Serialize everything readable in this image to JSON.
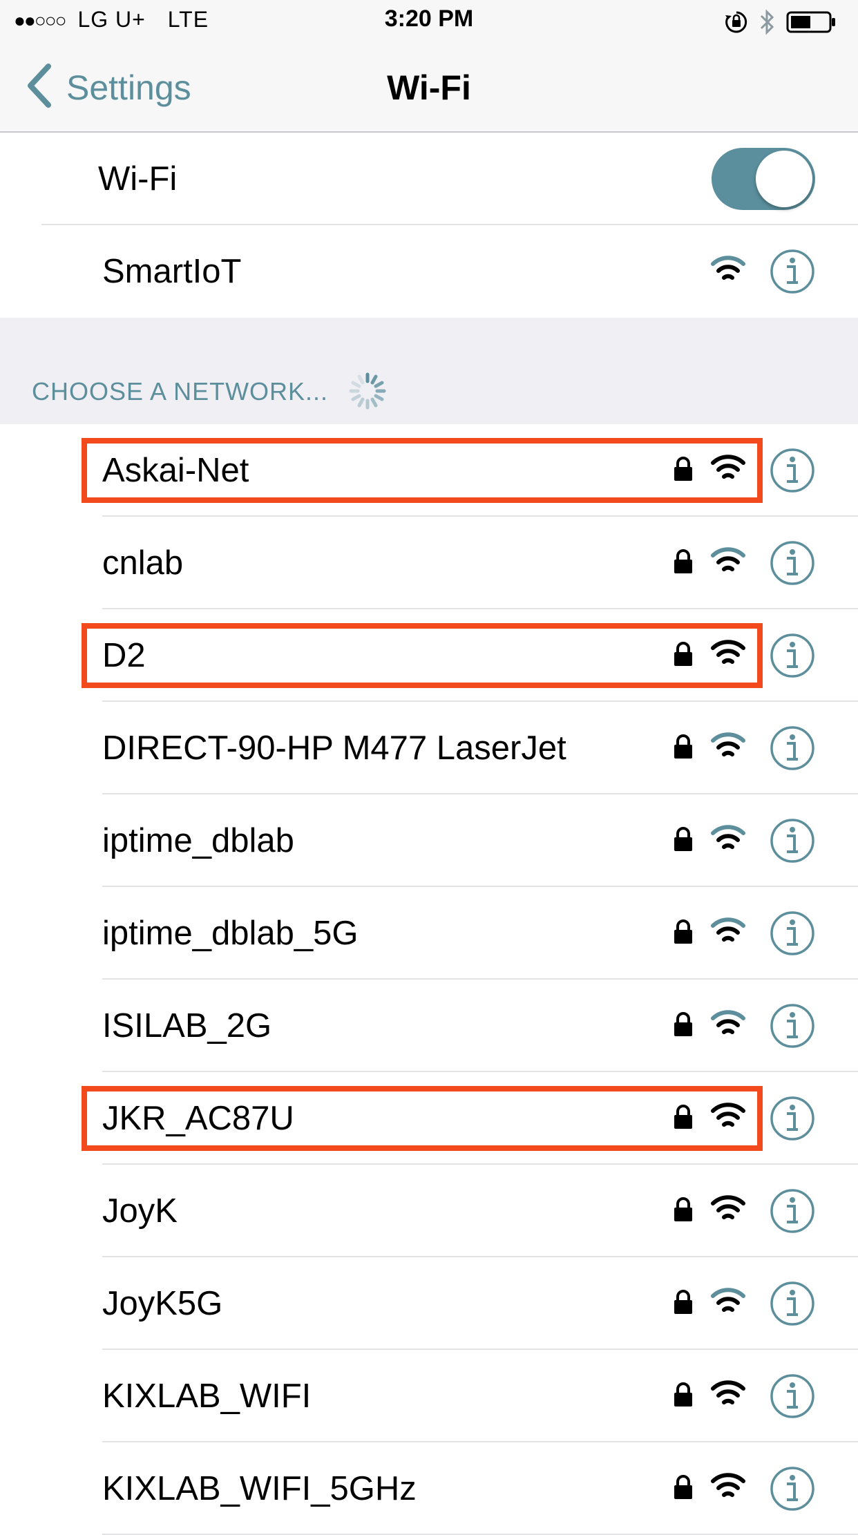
{
  "status_bar": {
    "signal": "●●○○○",
    "carrier": "LG U+",
    "network": "LTE",
    "time": "3:20 PM"
  },
  "nav": {
    "back_label": "Settings",
    "title": "Wi-Fi"
  },
  "wifi_toggle": {
    "label": "Wi-Fi",
    "on": true
  },
  "connected": {
    "name": "SmartIoT"
  },
  "section_header": "CHOOSE A NETWORK...",
  "colors": {
    "accent": "#5c8e9c",
    "toggle_on": "#5b8f9d",
    "highlight": "#f24a1d"
  },
  "networks": [
    {
      "name": "Askai-Net",
      "locked": true,
      "wifi_color": "black",
      "highlighted": true
    },
    {
      "name": "cnlab",
      "locked": true,
      "wifi_color": "teal",
      "highlighted": false
    },
    {
      "name": "D2",
      "locked": true,
      "wifi_color": "black",
      "highlighted": true
    },
    {
      "name": "DIRECT-90-HP M477 LaserJet",
      "locked": true,
      "wifi_color": "teal",
      "highlighted": false
    },
    {
      "name": "iptime_dblab",
      "locked": true,
      "wifi_color": "teal",
      "highlighted": false
    },
    {
      "name": "iptime_dblab_5G",
      "locked": true,
      "wifi_color": "teal",
      "highlighted": false
    },
    {
      "name": "ISILAB_2G",
      "locked": true,
      "wifi_color": "teal",
      "highlighted": false
    },
    {
      "name": "JKR_AC87U",
      "locked": true,
      "wifi_color": "black",
      "highlighted": true
    },
    {
      "name": "JoyK",
      "locked": true,
      "wifi_color": "black",
      "highlighted": false
    },
    {
      "name": "JoyK5G",
      "locked": true,
      "wifi_color": "teal",
      "highlighted": false
    },
    {
      "name": "KIXLAB_WIFI",
      "locked": true,
      "wifi_color": "black",
      "highlighted": false
    },
    {
      "name": "KIXLAB_WIFI_5GHz",
      "locked": true,
      "wifi_color": "black",
      "highlighted": false
    }
  ]
}
